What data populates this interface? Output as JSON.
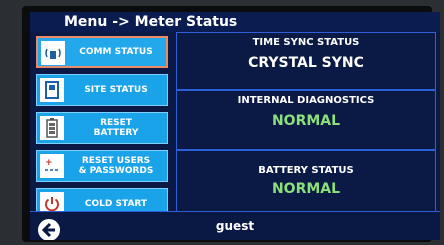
{
  "title": "Menu -> Meter Status",
  "menu": [
    {
      "label": "COMM STATUS",
      "icon": "wifi-antenna-icon",
      "active": true
    },
    {
      "label": "SITE STATUS",
      "icon": "site-door-icon",
      "active": false
    },
    {
      "label": "RESET\nBATTERY",
      "icon": "battery-icon",
      "active": false
    },
    {
      "label": "RESET USERS\n& PASSWORDS",
      "icon": "reset-users-icon",
      "active": false
    },
    {
      "label": "COLD START",
      "icon": "power-icon",
      "active": false
    }
  ],
  "status": [
    {
      "header": "TIME SYNC STATUS",
      "value": "CRYSTAL SYNC",
      "color": "#ffffff"
    },
    {
      "header": "INTERNAL DIAGNOSTICS",
      "value": "NORMAL",
      "color": "#8be07c"
    },
    {
      "header": "BATTERY STATUS",
      "value": "NORMAL",
      "color": "#8be07c"
    }
  ],
  "footer": {
    "user": "guest",
    "back_icon": "back-arrow-icon"
  },
  "colors": {
    "accent": "#1aa3e8",
    "panel_border": "#2d5fd8",
    "ok": "#8be07c",
    "active_border": "#e88a6a"
  }
}
